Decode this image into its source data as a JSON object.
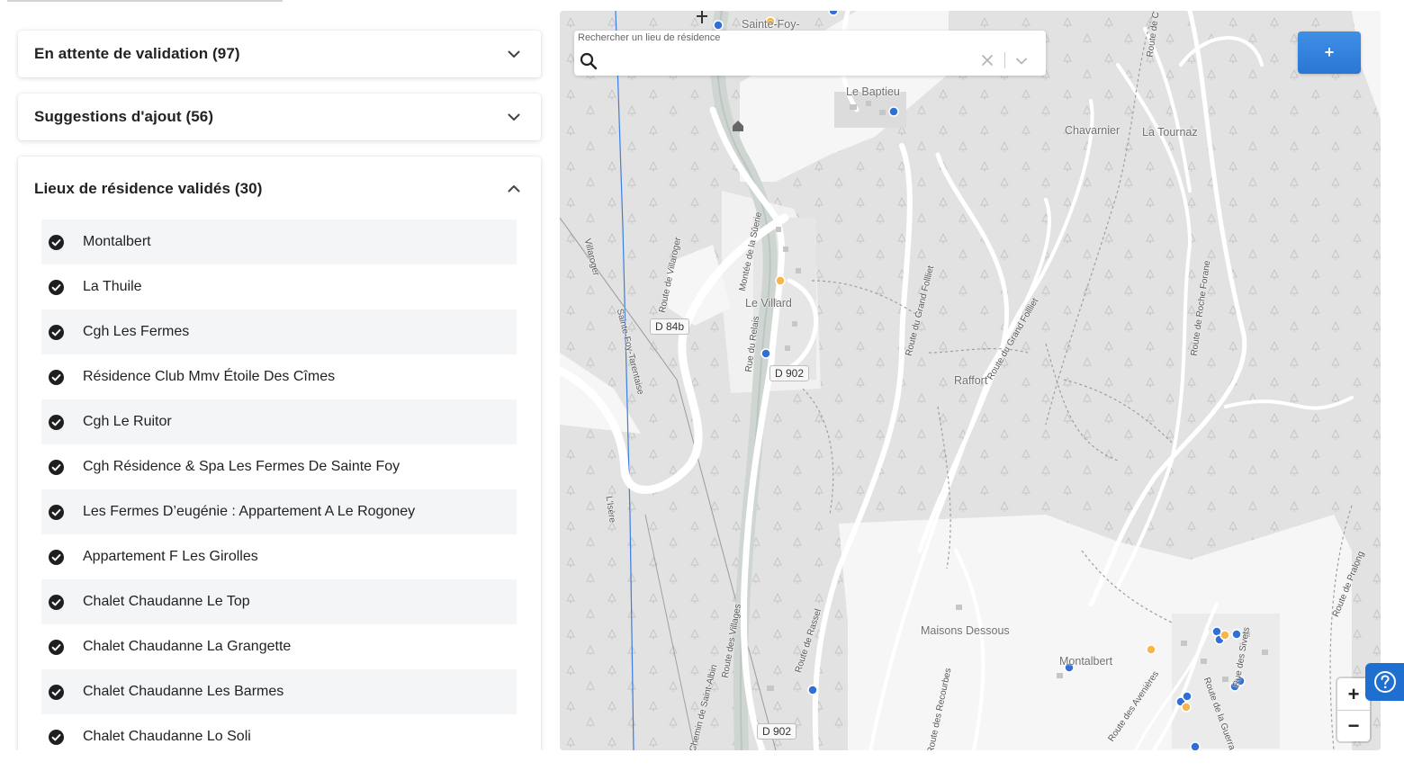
{
  "colors": {
    "accent": "#2a76d4",
    "marker_blue": "#2f6fd6",
    "marker_orange": "#f7b54a",
    "map_forest": "#e2e2e2",
    "map_open": "#f6f6f6"
  },
  "sections": {
    "pending": {
      "title": "En attente de validation (97)",
      "state": "collapsed"
    },
    "suggestions": {
      "title": "Suggestions d'ajout (56)",
      "state": "collapsed"
    },
    "validated": {
      "title": "Lieux de résidence validés (30)",
      "state": "expanded",
      "items": [
        {
          "label": "Montalbert"
        },
        {
          "label": "La Thuile"
        },
        {
          "label": "Cgh Les Fermes"
        },
        {
          "label": "Résidence Club Mmv Étoile Des Cîmes"
        },
        {
          "label": "Cgh Le Ruitor"
        },
        {
          "label": "Cgh Résidence & Spa Les Fermes De Sainte Foy"
        },
        {
          "label": "Les Fermes D’eugénie : Appartement A Le Rogoney"
        },
        {
          "label": "Appartement F Les Girolles"
        },
        {
          "label": "Chalet Chaudanne Le Top"
        },
        {
          "label": "Chalet Chaudanne La Grangette"
        },
        {
          "label": "Chalet Chaudanne Les Barmes"
        },
        {
          "label": "Chalet Chaudanne Lo Soli"
        }
      ]
    }
  },
  "icons": {
    "section_collapsed": "chevron-down-icon",
    "section_expanded": "chevron-up-icon",
    "validated_item": "check-circle-icon",
    "search": "search-icon",
    "clear": "close-icon",
    "dropdown": "chevron-down-icon",
    "help": "question-circle-icon"
  },
  "map": {
    "search": {
      "label": "Rechercher un lieu de résidence",
      "value": ""
    },
    "add_button": "+",
    "zoom_in": "+",
    "zoom_out": "−",
    "places": {
      "sainte_foy": "Sainte-Foy-",
      "le_baptieu": "Le Baptieu",
      "chavarnier": "Chavarnier",
      "la_tournaz": "La Tournaz",
      "le_villard": "Le Villard",
      "raffort": "Raffort",
      "maisons_dessous": "Maisons Dessous",
      "montalbert": "Montalbert"
    },
    "shields": {
      "d84b": "D 84b",
      "d902_a": "D 902",
      "d902_b": "D 902"
    },
    "roads": {
      "r1": "Route de Villaroger",
      "r2": "Montée de la Sûerie",
      "r3": "Rue du Relais",
      "r4": "Route du Grand Follliet",
      "r5": "Route du Grand Follliet",
      "r6": "Route de Roche Forane",
      "r7": "Route des Villages",
      "r8": "Chemin de Saint-Albin",
      "r9": "Route de Rassel",
      "r10": "Route des Recourbes",
      "r11": "Route des Avenières",
      "r12": "Route de la Guerra",
      "r13": "Rue des Sivets",
      "r14": "Route de Pralong",
      "r15": "Villaroger",
      "r16": "Sainte-Foy-Tarentaise",
      "r17": "L'Isère",
      "r18": "Route de C"
    }
  }
}
